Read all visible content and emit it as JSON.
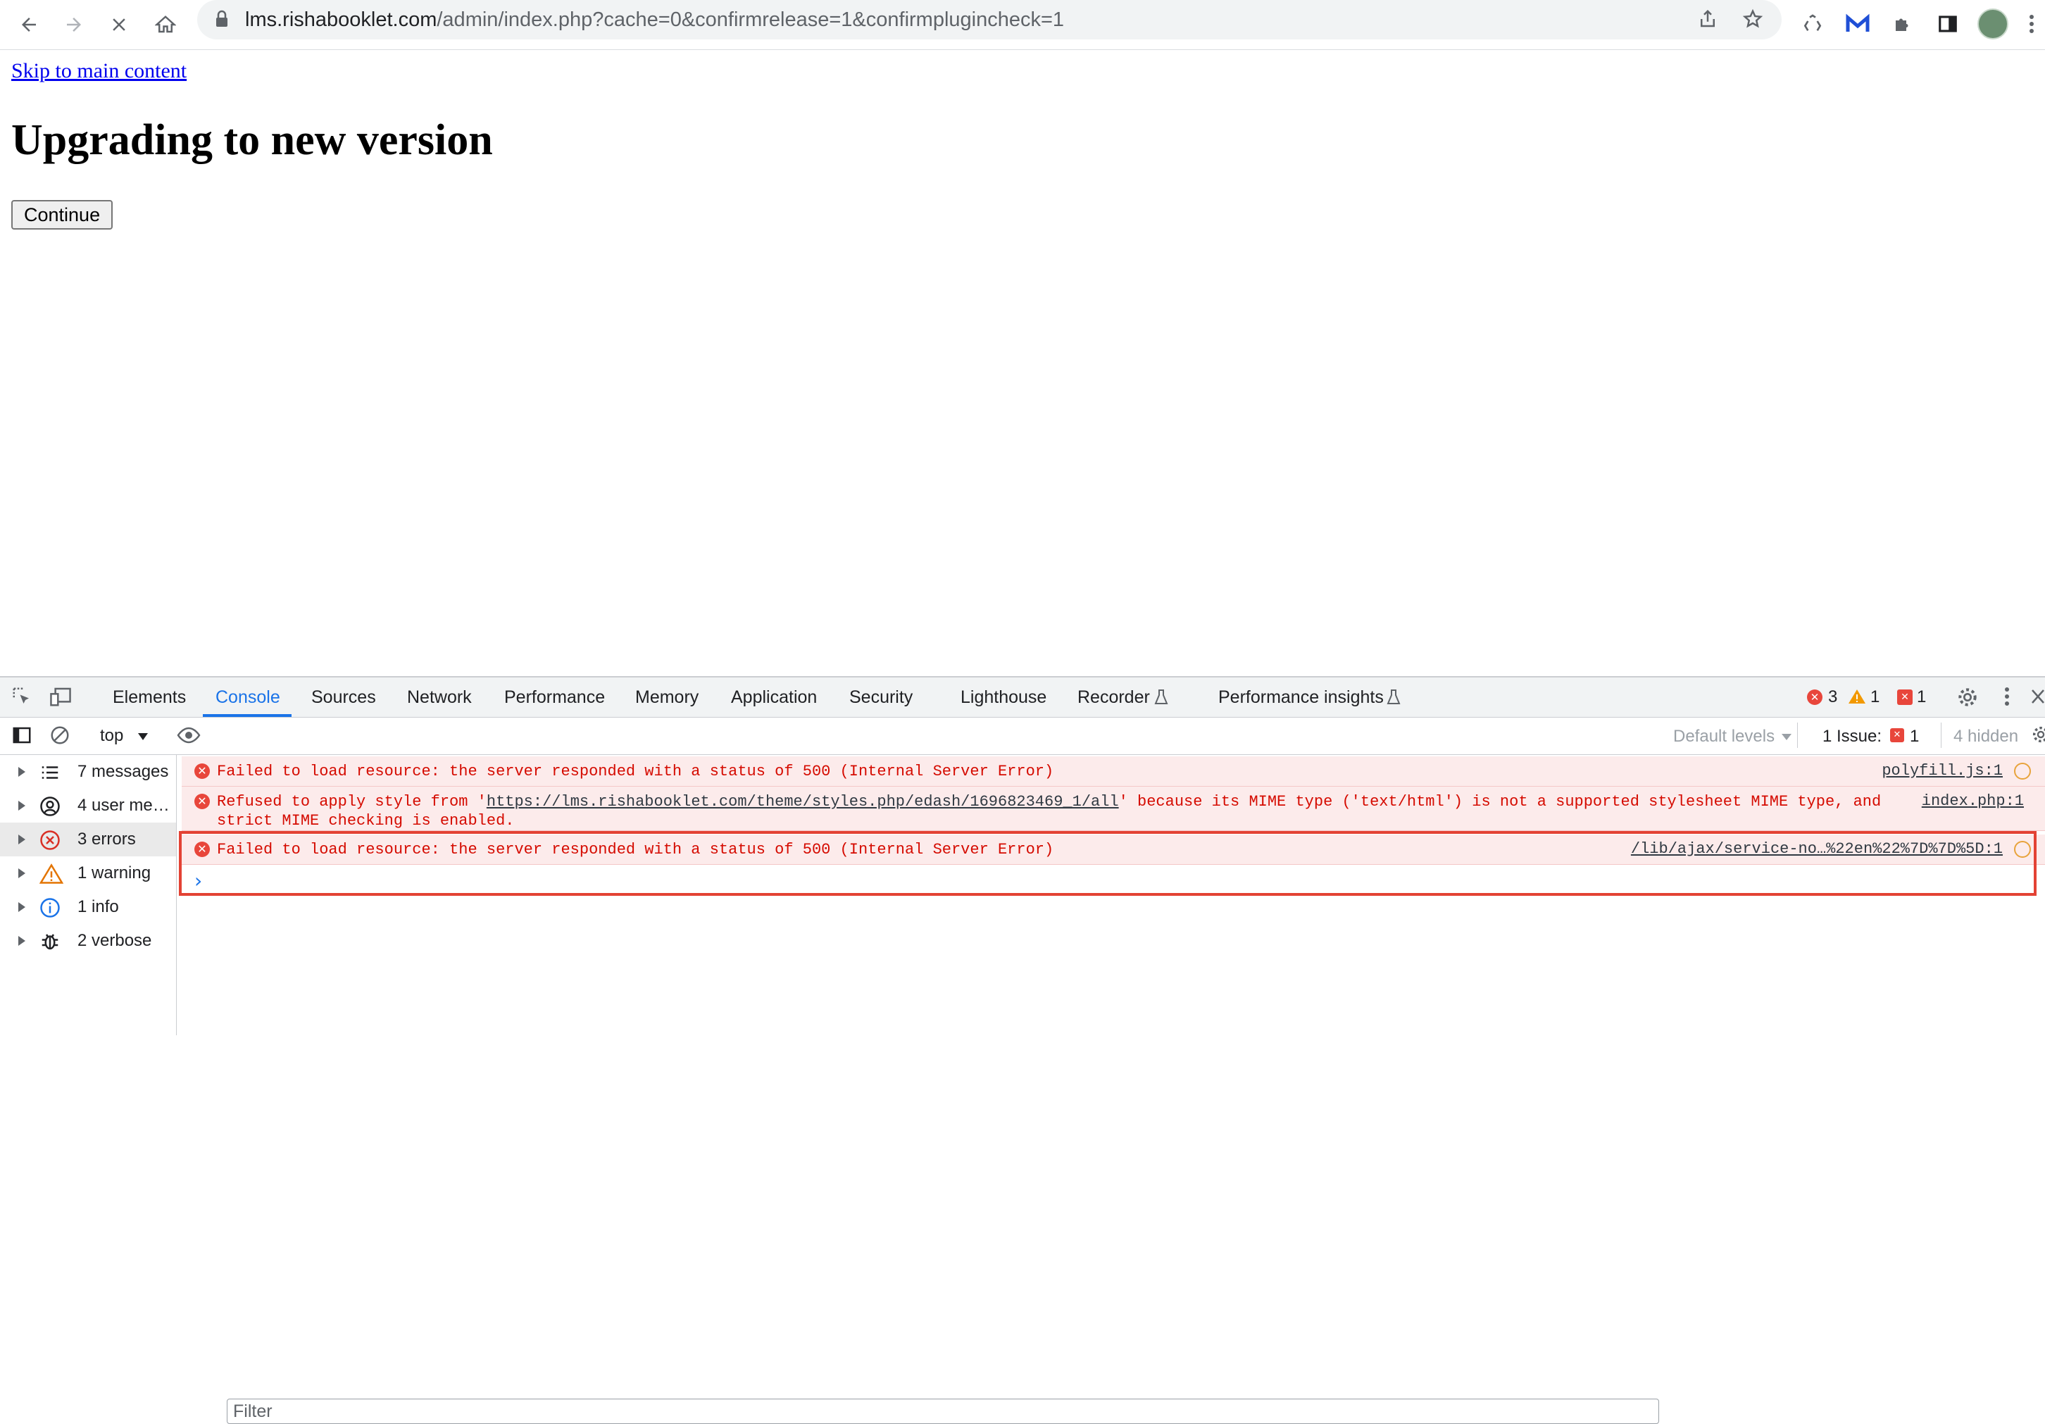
{
  "browser": {
    "url_domain": "lms.rishabooklet.com",
    "url_path": "/admin/index.php?cache=0&confirmrelease=1&confirmplugincheck=1"
  },
  "page": {
    "skip_link": "Skip to main content",
    "heading": "Upgrading to new version",
    "continue_button": "Continue"
  },
  "devtools": {
    "tabs": [
      "Elements",
      "Console",
      "Sources",
      "Network",
      "Performance",
      "Memory",
      "Application",
      "Security",
      "Lighthouse",
      "Recorder",
      "Performance insights"
    ],
    "active_tab": "Console",
    "counts": {
      "errors": "3",
      "warnings": "1",
      "issues": "1"
    },
    "toolbar": {
      "context": "top",
      "filter_placeholder": "Filter",
      "levels": "Default levels",
      "issues_label": "1 Issue:",
      "issues_count": "1",
      "hidden": "4 hidden"
    },
    "sidebar": [
      {
        "label": "7 messages",
        "icon": "list-icon"
      },
      {
        "label": "4 user me…",
        "icon": "user-icon"
      },
      {
        "label": "3 errors",
        "icon": "error-icon"
      },
      {
        "label": "1 warning",
        "icon": "warning-icon"
      },
      {
        "label": "1 info",
        "icon": "info-icon"
      },
      {
        "label": "2 verbose",
        "icon": "bug-icon"
      }
    ],
    "messages": [
      {
        "text": "Failed to load resource: the server responded with a status of 500 (Internal Server Error)",
        "source": "polyfill.js:1"
      },
      {
        "text_before": "Refused to apply style from '",
        "link": "https://lms.rishabooklet.com/theme/styles.php/edash/1696823469_1/all",
        "text_after": "' because its MIME type ('text/html') is not a supported stylesheet MIME type, and",
        "text_line2": "strict MIME checking is enabled.",
        "source": "index.php:1"
      },
      {
        "text": "Failed to load resource: the server responded with a status of 500 (Internal Server Error)",
        "source": "/lib/ajax/service-no…%22en%22%7D%7D%5D:1"
      }
    ],
    "prompt": "›"
  },
  "colors": {
    "accent": "#1a73e8",
    "error_text": "#d50b00",
    "error_bg": "#fcebeb",
    "highlight_box": "#e34234"
  }
}
